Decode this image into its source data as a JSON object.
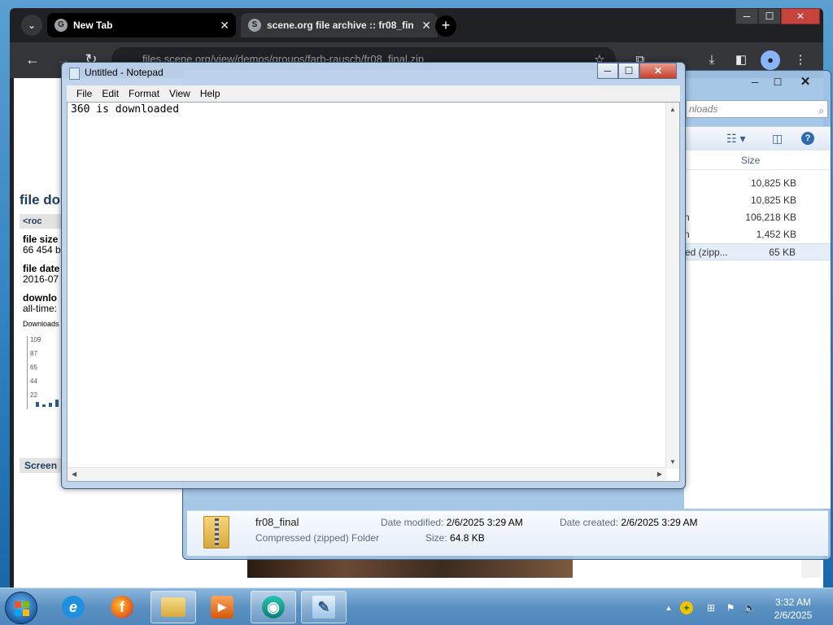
{
  "browser": {
    "tabs": [
      {
        "title": "New Tab",
        "favicon": "G"
      },
      {
        "title": "scene.org file archive :: fr08_fin",
        "favicon": "S"
      }
    ],
    "url": "files.scene.org/view/demos/groups/farb-rausch/fr08_final.zip",
    "page": {
      "title": "file do",
      "product_label": "<roc",
      "file_size_label": "file size",
      "file_size_value": "66 454 b",
      "file_date_label": "file date",
      "file_date_value": "2016-07",
      "downloads_label": "downlo",
      "downloads_value": "all-time:",
      "chart_label": "Downloads",
      "chart_ticks": [
        "109",
        "87",
        "65",
        "44",
        "22"
      ],
      "screenshot_label": "Screen"
    }
  },
  "explorer": {
    "search_placeholder": "nloads",
    "columns": {
      "size": "Size"
    },
    "rows": [
      {
        "name": "",
        "size": "10,825 KB"
      },
      {
        "name": "",
        "size": "10,825 KB"
      },
      {
        "name": "n",
        "size": "106,218 KB"
      },
      {
        "name": "n",
        "size": "1,452 KB"
      },
      {
        "name": "ed (zipp...",
        "size": "65 KB"
      }
    ],
    "details": {
      "name": "fr08_final",
      "type": "Compressed (zipped) Folder",
      "modified_label": "Date modified:",
      "modified_value": "2/6/2025 3:29 AM",
      "created_label": "Date created:",
      "created_value": "2/6/2025 3:29 AM",
      "size_label": "Size:",
      "size_value": "64.8 KB"
    }
  },
  "notepad": {
    "title": "Untitled - Notepad",
    "menu": [
      "File",
      "Edit",
      "Format",
      "View",
      "Help"
    ],
    "content": "360 is downloaded"
  },
  "taskbar": {
    "apps": [
      {
        "name": "internet-explorer",
        "glyph": "e",
        "color": "#1f8fe0"
      },
      {
        "name": "firefox",
        "glyph": "f",
        "color": "#e8641c"
      },
      {
        "name": "file-explorer",
        "glyph": "",
        "color": "#e7c25a"
      },
      {
        "name": "media-player",
        "glyph": "▶",
        "color": "#e36f16"
      },
      {
        "name": "chrome-like",
        "glyph": "◉",
        "color": "#0e9a8e"
      },
      {
        "name": "notepad",
        "glyph": "✎",
        "color": "#a9cbe9"
      }
    ],
    "time": "3:32 AM",
    "date": "2/6/2025"
  }
}
